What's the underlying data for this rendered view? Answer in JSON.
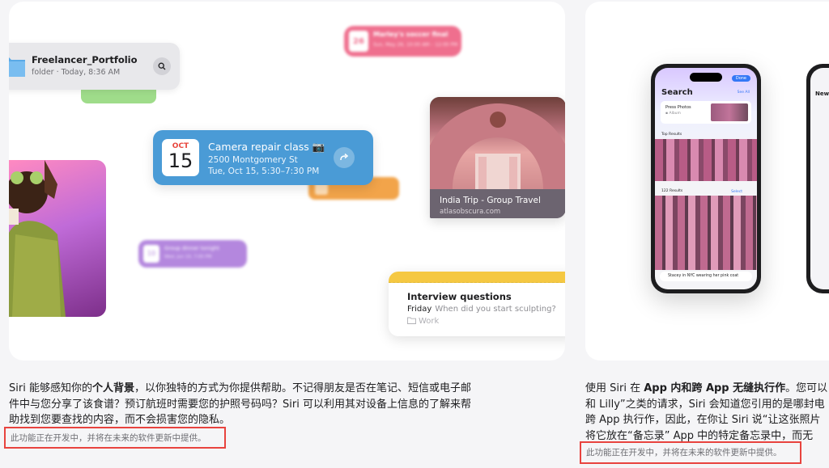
{
  "left_card": {
    "folder": {
      "title": "Freelancer_Portfolio",
      "subtitle": "folder · Today, 8:36 AM"
    },
    "pink_event": {
      "day": "26",
      "title": "Marley's soccer final",
      "subtitle": "Sun, May 26, 10:00 AM – 12:00 PM"
    },
    "purple_event": {
      "day": "10",
      "title": "Group dinner tonight",
      "subtitle": "Wed, Jun 10, 7:00 PM"
    },
    "event": {
      "month": "OCT",
      "day": "15",
      "title": "Camera repair class 📷",
      "address": "2500 Montgomery St",
      "time": "Tue, Oct 15, 5:30–7:30 PM"
    },
    "travel": {
      "title": "India Trip - Group Travel",
      "source": "atlasobscura.com"
    },
    "note": {
      "title": "Interview questions",
      "day": "Friday",
      "question": "When did you start sculpting?",
      "folder": "Work"
    }
  },
  "right_card": {
    "phone": {
      "done_label": "Done",
      "search_title": "Search",
      "see_all": "See All",
      "album_title": "Press Photos",
      "album_sub": "Album",
      "top_results": "Top Results",
      "results_count": "122 Results",
      "select_label": "Select",
      "query": "Stacey in NYC wearing her pink coat"
    },
    "phone2_title": "New"
  },
  "descriptions": {
    "left": {
      "p1": "Siri 能够感知你的",
      "b1": "个人背景",
      "p2": "，以你独特的方式为你提供帮助。不记得朋友是否在笔记、短信或电子邮件中与您分享了该食谱？预订航班时需要您的护照号码吗？Siri 可以利用其对设备上信息的了解来帮助找到您要查找的内容，而不会损害您的隐私。"
    },
    "left_note": "此功能正在开发中，并将在未来的软件更新中提供。",
    "right": {
      "line1_a": "使用 Siri 在 ",
      "line1_b": "App 内和跨 App 无缝执行作",
      "line1_c": "。您可以",
      "line2": "和 Lilly”之类的请求，Siri 会知道您引用的是哪封电",
      "line3": "跨 App 执行作，因此，在你让 Siri 说“让这张照片",
      "line4": "将它放在“备忘录” App 中的特定备忘录中，而无"
    },
    "right_note": "此功能正在开发中，并将在未来的软件更新中提供。"
  }
}
